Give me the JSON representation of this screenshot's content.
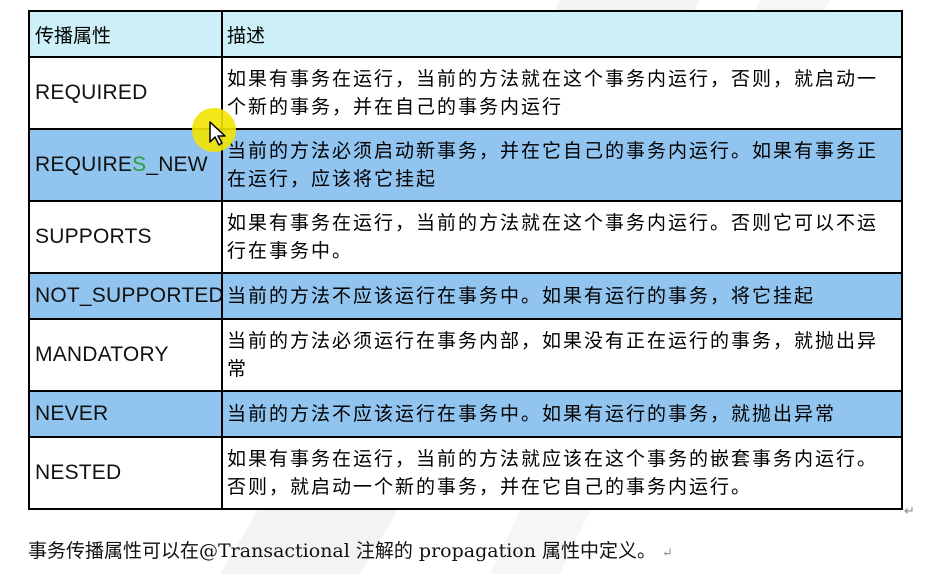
{
  "table": {
    "headers": [
      "传播属性",
      "描述"
    ],
    "rows": [
      {
        "name": "REQUIRED",
        "desc": "如果有事务在运行，当前的方法就在这个事务内运行，否则，就启动一个新的事务，并在自己的事务内运行"
      },
      {
        "name_a": "REQUIRE",
        "name_b": "S",
        "name_c": "_NEW",
        "desc": "当前的方法必须启动新事务，并在它自己的事务内运行。如果有事务正在运行，应该将它挂起"
      },
      {
        "name": "SUPPORTS",
        "desc": "如果有事务在运行，当前的方法就在这个事务内运行。否则它可以不运行在事务中。"
      },
      {
        "name": "NOT_SUPPORTED",
        "desc": "当前的方法不应该运行在事务中。如果有运行的事务，将它挂起"
      },
      {
        "name": "MANDATORY",
        "desc": "当前的方法必须运行在事务内部，如果没有正在运行的事务，就抛出异常"
      },
      {
        "name": "NEVER",
        "desc": "当前的方法不应该运行在事务中。如果有运行的事务，就抛出异常"
      },
      {
        "name": "NESTED",
        "desc": "如果有事务在运行，当前的方法就应该在这个事务的嵌套事务内运行。否则，就启动一个新的事务，并在它自己的事务内运行。"
      }
    ]
  },
  "footer": {
    "text": "事务传播属性可以在@Transactional 注解的 propagation 属性中定义。",
    "mark": "↵"
  },
  "table_mark": "↵",
  "colors": {
    "header_bg": "#cdeff8",
    "highlight_row": "#92c4f0",
    "cursor_highlight": "#f2e400"
  },
  "icons": {
    "cursor": "arrow-cursor-icon"
  }
}
